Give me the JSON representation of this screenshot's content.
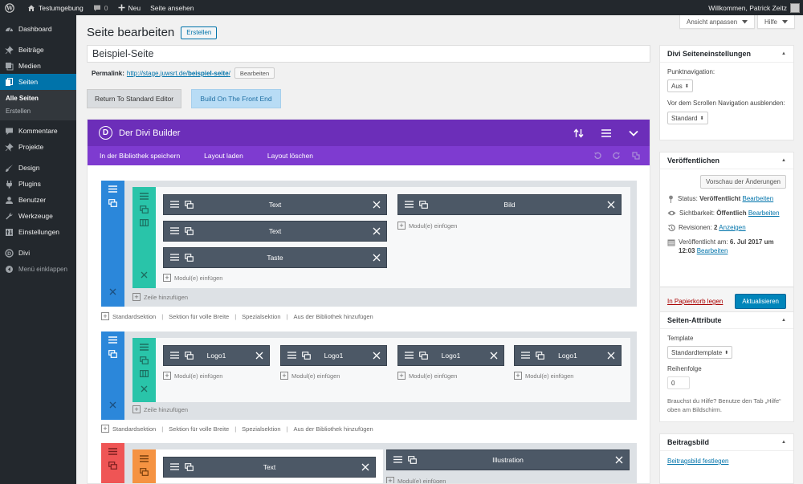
{
  "admin_bar": {
    "site_name": "Testumgebung",
    "comments_count": "0",
    "new_label": "Neu",
    "view_page": "Seite ansehen",
    "welcome": "Willkommen, Patrick Zeitz"
  },
  "sidebar": {
    "items": [
      {
        "label": "Dashboard",
        "icon": "dashboard-icon"
      },
      {
        "label": "Beiträge",
        "icon": "pin-icon"
      },
      {
        "label": "Medien",
        "icon": "media-icon"
      },
      {
        "label": "Seiten",
        "icon": "pages-icon"
      },
      {
        "label": "Kommentare",
        "icon": "comment-icon"
      },
      {
        "label": "Projekte",
        "icon": "pin-icon"
      },
      {
        "label": "Design",
        "icon": "brush-icon"
      },
      {
        "label": "Plugins",
        "icon": "plugin-icon"
      },
      {
        "label": "Benutzer",
        "icon": "user-icon"
      },
      {
        "label": "Werkzeuge",
        "icon": "wrench-icon"
      },
      {
        "label": "Einstellungen",
        "icon": "settings-icon"
      },
      {
        "label": "Divi",
        "icon": "divi-icon"
      },
      {
        "label": "Menü einklappen",
        "icon": "collapse-icon"
      }
    ],
    "submenu": [
      "Alle Seiten",
      "Erstellen"
    ]
  },
  "top_buttons": {
    "screen_options": "Ansicht anpassen",
    "help": "Hilfe"
  },
  "page": {
    "heading": "Seite bearbeiten",
    "add_new": "Erstellen",
    "title_value": "Beispiel-Seite",
    "permalink_label": "Permalink:",
    "permalink_base": "http://stage.juwsrt.de/",
    "permalink_slug": "beispiel-seite",
    "permalink_end": "/",
    "permalink_edit": "Bearbeiten",
    "return_editor": "Return To Standard Editor",
    "front_end": "Build On The Front End"
  },
  "divi": {
    "title": "Der Divi Builder",
    "logo_letter": "D",
    "toolbar": [
      "In der Bibliothek speichern",
      "Layout laden",
      "Layout löschen"
    ],
    "add_module": "Modul(e) einfügen",
    "add_row": "Zeile hinzufügen",
    "section_links": [
      "Standardsektion",
      "Sektion für volle Breite",
      "Spezialsektion",
      "Aus der Bibliothek hinzufügen"
    ],
    "section1": {
      "col1": [
        "Text",
        "Text",
        "Taste"
      ],
      "col2": [
        "Bild"
      ]
    },
    "section2": {
      "modules": [
        "Logo1",
        "Logo1",
        "Logo1",
        "Logo1"
      ]
    },
    "section3": {
      "col1": [
        "Text"
      ],
      "col2": [
        "Illustration"
      ]
    },
    "colors": {
      "header": "#6c2eb9",
      "subbar": "#7e3bd0",
      "section_blue": "#2b87da",
      "row_teal": "#29c4a9",
      "section_red": "#ef5555",
      "row_orange": "#f59342",
      "module": "#4c5866"
    }
  },
  "divi_settings": {
    "title": "Divi Seiteneinstellungen",
    "dot_nav_label": "Punktnavigation:",
    "dot_nav_value": "Aus",
    "hide_nav_label": "Vor dem Scrollen Navigation ausblenden:",
    "hide_nav_value": "Standard"
  },
  "publish": {
    "title": "Veröffentlichen",
    "preview": "Vorschau der Änderungen",
    "status_label": "Status:",
    "status_value": "Veröffentlicht",
    "visibility_label": "Sichtbarkeit:",
    "visibility_value": "Öffentlich",
    "revisions_label": "Revisionen:",
    "revisions_count": "2",
    "revisions_link": "Anzeigen",
    "published_label": "Veröffentlicht am:",
    "published_date": "6. Jul 2017 um",
    "published_time": "12:03",
    "edit": "Bearbeiten",
    "trash": "In Papierkorb legen",
    "update": "Aktualisieren"
  },
  "attributes": {
    "title": "Seiten-Attribute",
    "template_label": "Template",
    "template_value": "Standardtemplate",
    "order_label": "Reihenfolge",
    "order_value": "0",
    "help_text": "Brauchst du Hilfe? Benutze den Tab „Hilfe“ oben am Bildschirm."
  },
  "featured": {
    "title": "Beitragsbild",
    "link": "Beitragsbild festlegen"
  }
}
